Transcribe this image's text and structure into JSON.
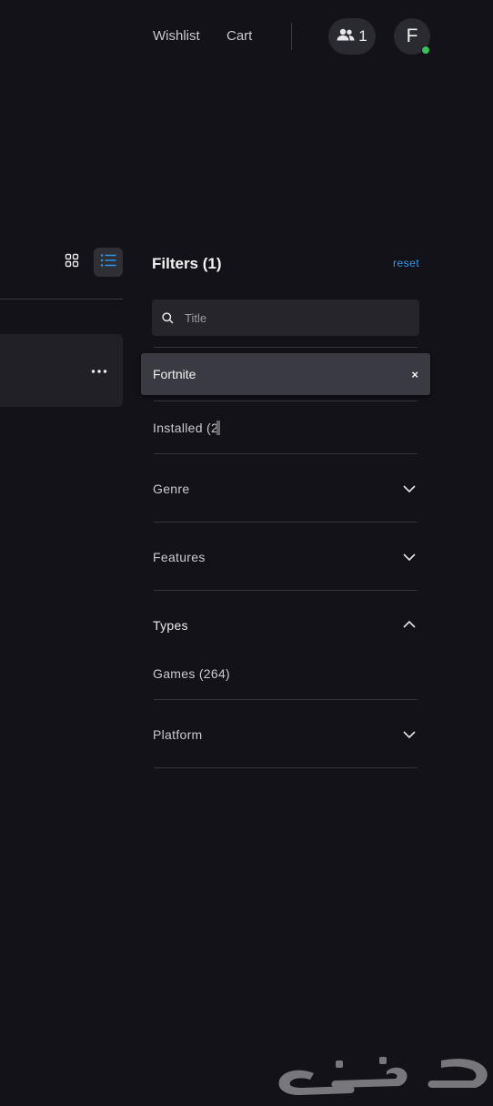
{
  "header": {
    "nav": {
      "wishlist": "Wishlist",
      "cart": "Cart"
    },
    "friends_count": "1",
    "avatar_initial": "F",
    "status": "online"
  },
  "library": {
    "views": [
      "grid-view",
      "list-view"
    ],
    "active_view": "list-view"
  },
  "filters": {
    "title": "Filters (1)",
    "reset_label": "reset",
    "search": {
      "placeholder": "Title",
      "value": ""
    },
    "active_chip": {
      "label": "Fortnite",
      "remove": "×"
    },
    "installed_label": "Installed (2",
    "groups": {
      "genre": "Genre",
      "features": "Features",
      "types": "Types",
      "types_option": "Games (264)",
      "platform": "Platform"
    }
  },
  "colors": {
    "background": "#121218",
    "accent_link": "#2d9bf0",
    "online": "#35c25a",
    "active_view_icon": "#2d9bf0"
  },
  "watermark": "حراج"
}
